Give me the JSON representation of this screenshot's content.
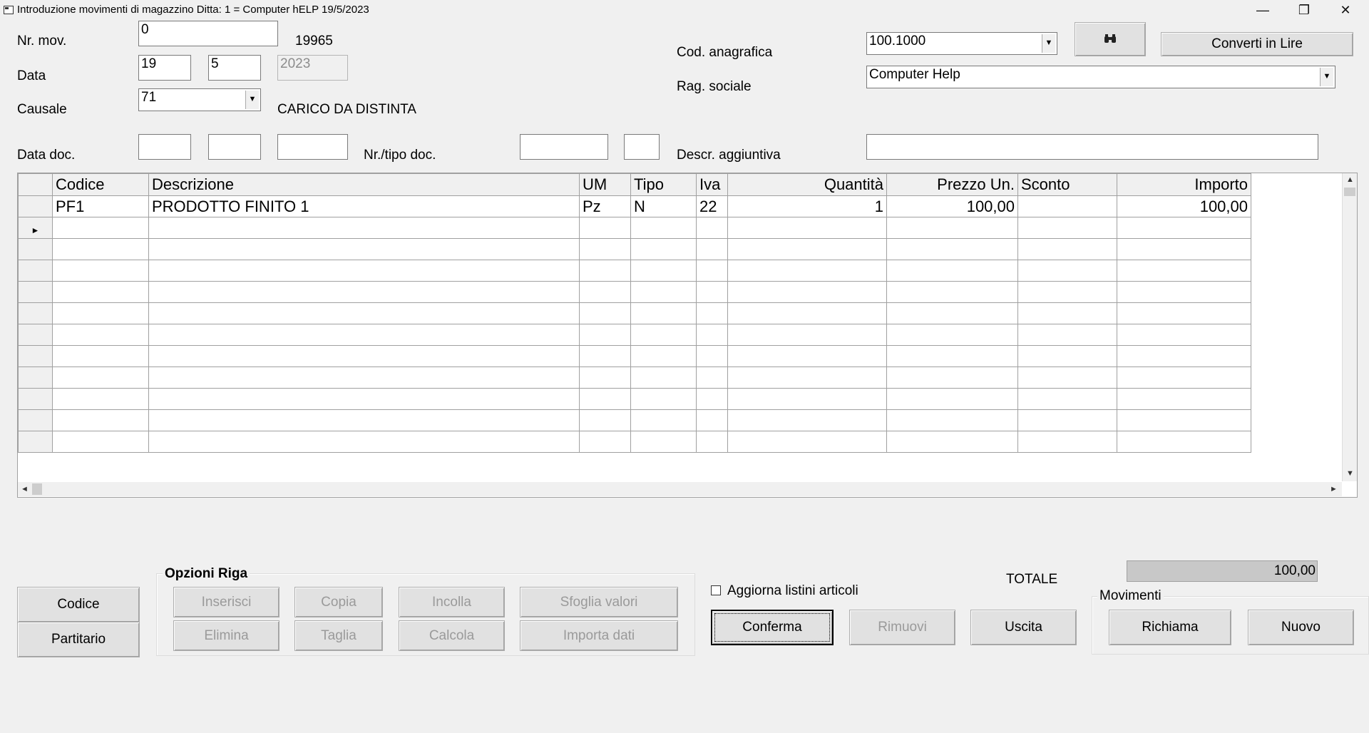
{
  "window": {
    "title": "Introduzione movimenti di magazzino  Ditta: 1 = Computer hELP  19/5/2023",
    "minimize": "—",
    "maximize": "❐",
    "close": "✕"
  },
  "form": {
    "nr_mov_label": "Nr. mov.",
    "nr_mov_value": "0",
    "nr_mov_number": "19965",
    "data_label": "Data",
    "data_day": "19",
    "data_month": "5",
    "data_year": "2023",
    "causale_label": "Causale",
    "causale_value": "71",
    "causale_desc": "CARICO DA DISTINTA",
    "data_doc_label": "Data doc.",
    "data_doc_day": "",
    "data_doc_month": "",
    "data_doc_year": "",
    "nr_tipo_doc_label": "Nr./tipo doc.",
    "nr_doc_value": "",
    "tipo_doc_value": "",
    "cod_anagrafica_label": "Cod. anagrafica",
    "cod_anagrafica_value": "100.1000",
    "rag_sociale_label": "Rag. sociale",
    "rag_sociale_value": "Computer Help",
    "descr_aggiuntiva_label": "Descr. aggiuntiva",
    "descr_aggiuntiva_value": "",
    "search_icon": "binoculars-icon",
    "converti_label": "Converti in Lire"
  },
  "grid": {
    "columns": [
      "Codice",
      "Descrizione",
      "UM",
      "Tipo",
      "Iva",
      "Quantità",
      "Prezzo Un.",
      "Sconto",
      "Importo"
    ],
    "rows": [
      [
        "PF1",
        "PRODOTTO FINITO 1",
        "Pz",
        "N",
        "22",
        "1",
        "100,00",
        "",
        "100,00"
      ]
    ],
    "current_row_marker": "►"
  },
  "buttons_left": {
    "codice": "Codice",
    "partitario": "Partitario"
  },
  "opzioni_riga": {
    "title": "Opzioni Riga",
    "inserisci": "Inserisci",
    "copia": "Copia",
    "incolla": "Incolla",
    "sfoglia_valori": "Sfoglia valori",
    "elimina": "Elimina",
    "taglia": "Taglia",
    "calcola": "Calcola",
    "importa_dati": "Importa dati"
  },
  "aggiorna_listini": {
    "label": "Aggiorna listini articoli",
    "checked": false
  },
  "totale": {
    "label": "TOTALE",
    "value": "100,00"
  },
  "actions": {
    "conferma": "Conferma",
    "rimuovi": "Rimuovi",
    "uscita": "Uscita"
  },
  "movimenti": {
    "title": "Movimenti",
    "richiama": "Richiama",
    "nuovo": "Nuovo"
  }
}
